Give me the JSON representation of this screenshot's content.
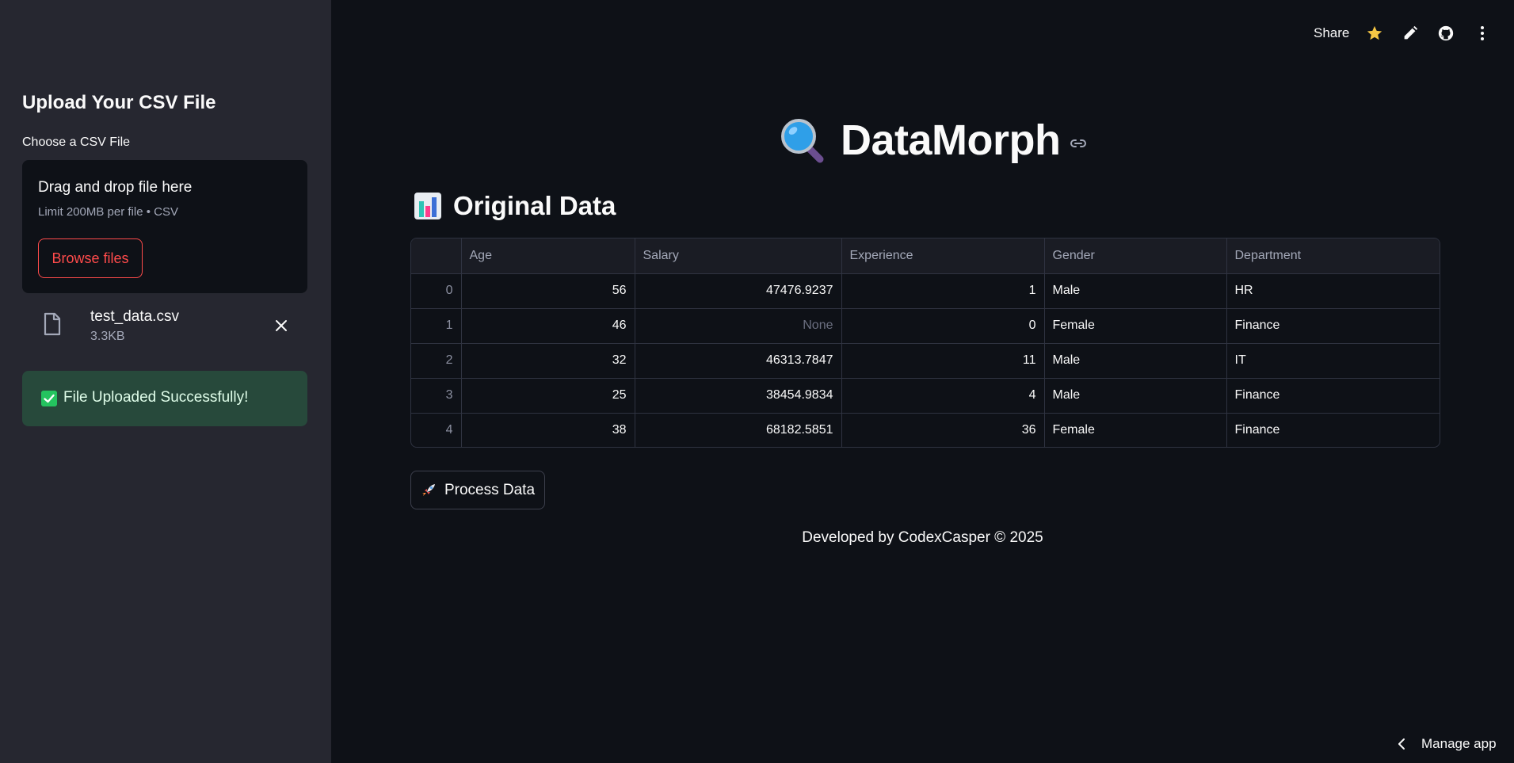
{
  "sidebar": {
    "title": "Upload Your CSV File",
    "uploader_label": "Choose a CSV File",
    "dropzone": {
      "title": "Drag and drop file here",
      "limit": "Limit 200MB per file • CSV",
      "browse_label": "Browse files"
    },
    "file": {
      "name": "test_data.csv",
      "size": "3.3KB"
    },
    "success_message": "File Uploaded Successfully!"
  },
  "toolbar": {
    "share_label": "Share"
  },
  "main": {
    "title": "DataMorph",
    "section_title": "Original Data",
    "table": {
      "columns": [
        "",
        "Age",
        "Salary",
        "Experience",
        "Gender",
        "Department"
      ],
      "rows": [
        [
          "0",
          "56",
          "47476.9237",
          "1",
          "Male",
          "HR"
        ],
        [
          "1",
          "46",
          "None",
          "0",
          "Female",
          "Finance"
        ],
        [
          "2",
          "32",
          "46313.7847",
          "11",
          "Male",
          "IT"
        ],
        [
          "3",
          "25",
          "38454.9834",
          "4",
          "Male",
          "Finance"
        ],
        [
          "4",
          "38",
          "68182.5851",
          "36",
          "Female",
          "Finance"
        ]
      ]
    },
    "process_button": "Process Data",
    "footer": "Developed by CodexCasper © 2025"
  },
  "manage_app": "Manage app",
  "colors": {
    "background": "#0e1117",
    "sidebar": "#262730",
    "accent": "#ff4b4b",
    "success_bg": "#27493b"
  }
}
